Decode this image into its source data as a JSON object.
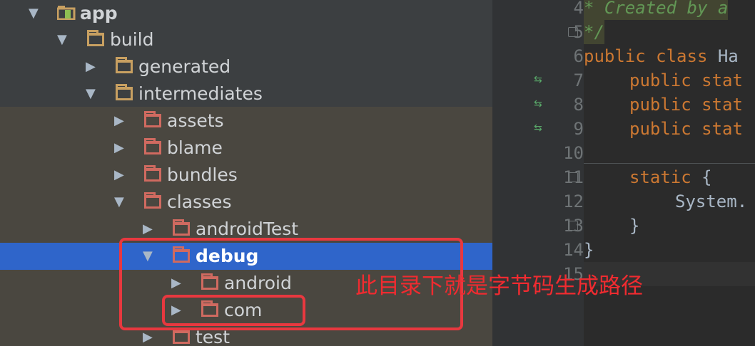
{
  "tree": {
    "items": [
      {
        "label": "app",
        "arrow": "▼",
        "icon": "module-icon"
      },
      {
        "label": "build",
        "arrow": "▼",
        "icon": "folder-icon"
      },
      {
        "label": "generated",
        "arrow": "▶",
        "icon": "folder-icon"
      },
      {
        "label": "intermediates",
        "arrow": "▼",
        "icon": "folder-icon"
      },
      {
        "label": "assets",
        "arrow": "▶",
        "icon": "excluded-folder-icon"
      },
      {
        "label": "blame",
        "arrow": "▶",
        "icon": "excluded-folder-icon"
      },
      {
        "label": "bundles",
        "arrow": "▶",
        "icon": "excluded-folder-icon"
      },
      {
        "label": "classes",
        "arrow": "▼",
        "icon": "excluded-folder-icon"
      },
      {
        "label": "androidTest",
        "arrow": "▶",
        "icon": "excluded-folder-icon"
      },
      {
        "label": "debug",
        "arrow": "▼",
        "icon": "excluded-folder-icon",
        "selected": true
      },
      {
        "label": "android",
        "arrow": "▶",
        "icon": "excluded-folder-icon"
      },
      {
        "label": "com",
        "arrow": "▶",
        "icon": "excluded-folder-icon"
      },
      {
        "label": "test",
        "arrow": "▶",
        "icon": "excluded-folder-icon"
      }
    ]
  },
  "editor": {
    "line_numbers": [
      "4",
      "5",
      "6",
      "7",
      "8",
      "9",
      "10",
      "11",
      "12",
      "13",
      "14",
      "15"
    ],
    "lines": {
      "l4": "* Created by a",
      "l5": "*/",
      "l6_kw": "public class ",
      "l6_name": "Ha",
      "l7": "public stat",
      "l8": "public stat",
      "l9": "public stat",
      "l11": "static",
      "l11_brace": " {",
      "l12": "System.",
      "l13": "}",
      "l14": "}"
    }
  },
  "annotation": {
    "text": "此目录下就是字节码生成路径",
    "color": "#f02b30"
  },
  "colors": {
    "selection": "#2f65ca",
    "folder": "#c8a061",
    "excluded_folder": "#d06a60",
    "keyword": "#cc7832",
    "comment": "#629755"
  }
}
